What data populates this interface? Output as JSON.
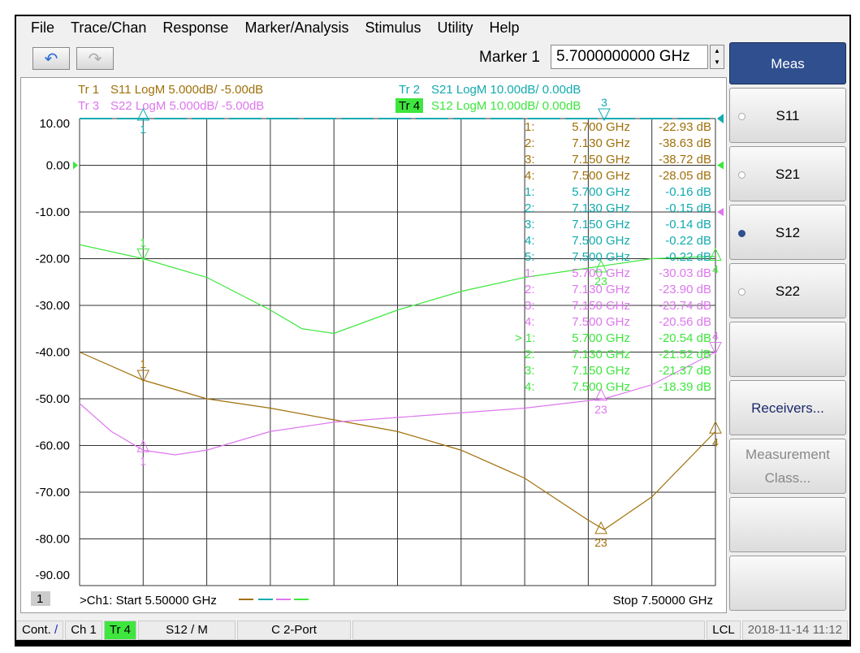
{
  "menu": [
    "File",
    "Trace/Chan",
    "Response",
    "Marker/Analysis",
    "Stimulus",
    "Utility",
    "Help"
  ],
  "toolbar": {
    "undo_icon": "undo-icon",
    "redo_icon": "redo-icon",
    "marker_label": "Marker 1",
    "marker_value": "5.7000000000 GHz"
  },
  "traces": [
    {
      "id": "Tr 1",
      "desc": "S11 LogM 5.000dB/  -5.00dB",
      "color": "#a0700a"
    },
    {
      "id": "Tr 2",
      "desc": "S21 LogM 10.00dB/  0.00dB",
      "color": "#13aab0"
    },
    {
      "id": "Tr 3",
      "desc": "S22 LogM 5.000dB/  -5.00dB",
      "color": "#dd77ee"
    },
    {
      "id": "Tr 4",
      "desc": "S12 LogM 10.00dB/  0.00dB",
      "color": "#3ee63e",
      "active": true
    }
  ],
  "yticks": [
    "10.00",
    "0.00",
    "-10.00",
    "-20.00",
    "-30.00",
    "-40.00",
    "-50.00",
    "-60.00",
    "-70.00",
    "-80.00",
    "-90.00"
  ],
  "chart_data": {
    "type": "line",
    "xlim": [
      5.5,
      7.5
    ],
    "ylim": [
      -90,
      10
    ],
    "grid": true,
    "series": [
      {
        "trace": "Tr 4",
        "color": "#3ee63e",
        "x": [
          5.5,
          5.7,
          5.9,
          6.1,
          6.2,
          6.3,
          6.5,
          6.7,
          6.9,
          7.1,
          7.3,
          7.5
        ],
        "y": [
          -17,
          -20,
          -24,
          -31,
          -35,
          -36,
          -31,
          -27,
          -24,
          -22,
          -20,
          -19.5
        ]
      },
      {
        "trace": "Tr 1",
        "color": "#a0700a",
        "x": [
          5.5,
          5.7,
          5.9,
          6.1,
          6.3,
          6.5,
          6.7,
          6.9,
          7.1,
          7.15,
          7.3,
          7.5
        ],
        "y": [
          -40,
          -46,
          -50,
          -52,
          -54.5,
          -57,
          -61,
          -67,
          -76,
          -78,
          -71,
          -57
        ]
      },
      {
        "trace": "Tr 3",
        "color": "#dd77ee",
        "x": [
          5.5,
          5.6,
          5.7,
          5.8,
          5.9,
          6.1,
          6.3,
          6.5,
          6.7,
          6.9,
          7.15,
          7.3,
          7.5
        ],
        "y": [
          -51,
          -57,
          -61,
          -62,
          -61,
          -57,
          -55,
          -54,
          -53,
          -52,
          -50,
          -47,
          -40
        ]
      },
      {
        "trace": "Tr 2",
        "color": "#13aab0",
        "dashed": true,
        "x": [
          5.5,
          7.5
        ],
        "y": [
          10,
          10
        ]
      }
    ],
    "markers": [
      {
        "label": "1",
        "color": "#13aab0",
        "x": 5.7,
        "y": 10,
        "dir": "up"
      },
      {
        "label": "3",
        "color": "#13aab0",
        "x": 7.15,
        "y": 10,
        "dir": "down"
      },
      {
        "label": "1",
        "color": "#3ee63e",
        "x": 5.7,
        "y": -20,
        "dir": "down"
      },
      {
        "label": "23",
        "color": "#3ee63e",
        "x": 7.14,
        "y": -22.5,
        "dir": "up"
      },
      {
        "label": "4",
        "color": "#3ee63e",
        "x": 7.5,
        "y": -20,
        "dir": "up"
      },
      {
        "label": "1",
        "color": "#a0700a",
        "x": 5.7,
        "y": -46,
        "dir": "down"
      },
      {
        "label": "23",
        "color": "#a0700a",
        "x": 7.14,
        "y": -78.5,
        "dir": "up"
      },
      {
        "label": "4",
        "color": "#a0700a",
        "x": 7.5,
        "y": -57,
        "dir": "up"
      },
      {
        "label": "1",
        "color": "#dd77ee",
        "x": 5.7,
        "y": -61,
        "dir": "up"
      },
      {
        "label": "23",
        "color": "#dd77ee",
        "x": 7.14,
        "y": -50,
        "dir": "up"
      },
      {
        "label": "4",
        "color": "#dd77ee",
        "x": 7.5,
        "y": -40,
        "dir": "down"
      }
    ],
    "marker_table": [
      {
        "c": "#a0700a",
        "n": "1:",
        "f": "5.700 GHz",
        "v": "-22.93 dB"
      },
      {
        "c": "#a0700a",
        "n": "2:",
        "f": "7.130 GHz",
        "v": "-38.63 dB"
      },
      {
        "c": "#a0700a",
        "n": "3:",
        "f": "7.150 GHz",
        "v": "-38.72 dB"
      },
      {
        "c": "#a0700a",
        "n": "4:",
        "f": "7.500 GHz",
        "v": "-28.05 dB"
      },
      {
        "c": "#13aab0",
        "n": "1:",
        "f": "5.700 GHz",
        "v": "-0.16 dB"
      },
      {
        "c": "#13aab0",
        "n": "2:",
        "f": "7.130 GHz",
        "v": "-0.15 dB"
      },
      {
        "c": "#13aab0",
        "n": "3:",
        "f": "7.150 GHz",
        "v": "-0.14 dB"
      },
      {
        "c": "#13aab0",
        "n": "4:",
        "f": "7.500 GHz",
        "v": "-0.22 dB"
      },
      {
        "c": "#13aab0",
        "n": "5:",
        "f": "7.500 GHz",
        "v": "-0.22 dB"
      },
      {
        "c": "#dd77ee",
        "n": "1:",
        "f": "5.700 GHz",
        "v": "-30.03 dB"
      },
      {
        "c": "#dd77ee",
        "n": "2:",
        "f": "7.130 GHz",
        "v": "-23.90 dB"
      },
      {
        "c": "#dd77ee",
        "n": "3:",
        "f": "7.150 GHz",
        "v": "-23.74 dB"
      },
      {
        "c": "#dd77ee",
        "n": "4:",
        "f": "7.500 GHz",
        "v": "-20.56 dB"
      },
      {
        "c": "#3ee63e",
        "n": "> 1:",
        "f": "5.700 GHz",
        "v": "-20.54 dB"
      },
      {
        "c": "#3ee63e",
        "n": "2:",
        "f": "7.130 GHz",
        "v": "-21.52 dB"
      },
      {
        "c": "#3ee63e",
        "n": "3:",
        "f": "7.150 GHz",
        "v": "-21.37 dB"
      },
      {
        "c": "#3ee63e",
        "n": "4:",
        "f": "7.500 GHz",
        "v": "-18.39 dB"
      }
    ]
  },
  "footer": {
    "channel_num": "1",
    "start": ">Ch1:  Start  5.50000 GHz",
    "stop": "Stop  7.50000 GHz"
  },
  "status": {
    "cont": "Cont.",
    "cont_icon": "/",
    "ch": "Ch 1",
    "tr": "Tr 4",
    "meas": "S12 / M",
    "cal": "C  2-Port",
    "lcl": "LCL",
    "datetime": "2018-11-14 11:12"
  },
  "side": {
    "head": "Meas",
    "items": [
      {
        "label": "S11",
        "radio": true,
        "on": false
      },
      {
        "label": "S21",
        "radio": true,
        "on": false
      },
      {
        "label": "S12",
        "radio": true,
        "on": true
      },
      {
        "label": "S22",
        "radio": true,
        "on": false
      },
      {
        "label": ""
      },
      {
        "label": "Receivers...",
        "cls": "link"
      },
      {
        "label": "Measurement Class...",
        "cls": "dis"
      },
      {
        "label": ""
      },
      {
        "label": ""
      }
    ]
  }
}
